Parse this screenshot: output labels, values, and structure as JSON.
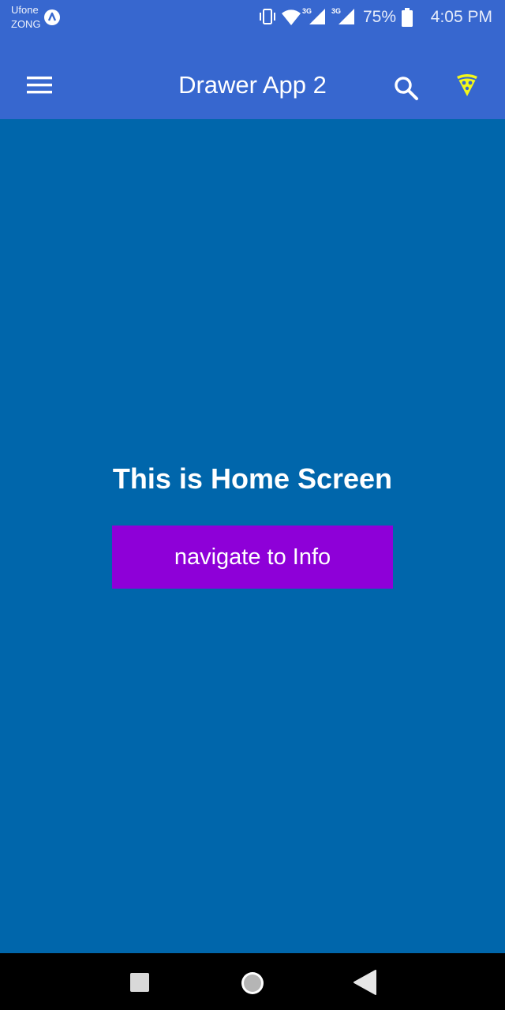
{
  "status_bar": {
    "carrier_1": "Ufone",
    "carrier_2": "ZONG",
    "carrier_badge_icon": "data-saver-icon",
    "network_label_1": "3G",
    "network_label_2": "3G",
    "battery_percent": "75%",
    "time": "4:05 PM"
  },
  "app_bar": {
    "title": "Drawer App 2",
    "menu_icon": "hamburger-menu-icon",
    "search_icon": "search-icon",
    "pizza_icon": "pizza-icon"
  },
  "main": {
    "heading": "This is Home Screen",
    "button_label": "navigate to Info"
  },
  "nav_bar": {
    "recents_icon": "square-recents-icon",
    "home_icon": "circle-home-icon",
    "back_icon": "triangle-back-icon"
  },
  "colors": {
    "app_bar": "#3767cf",
    "background": "#0066ab",
    "button": "#8e00d8",
    "pizza_icon": "#f3f71a",
    "nav_bar": "#000000"
  }
}
